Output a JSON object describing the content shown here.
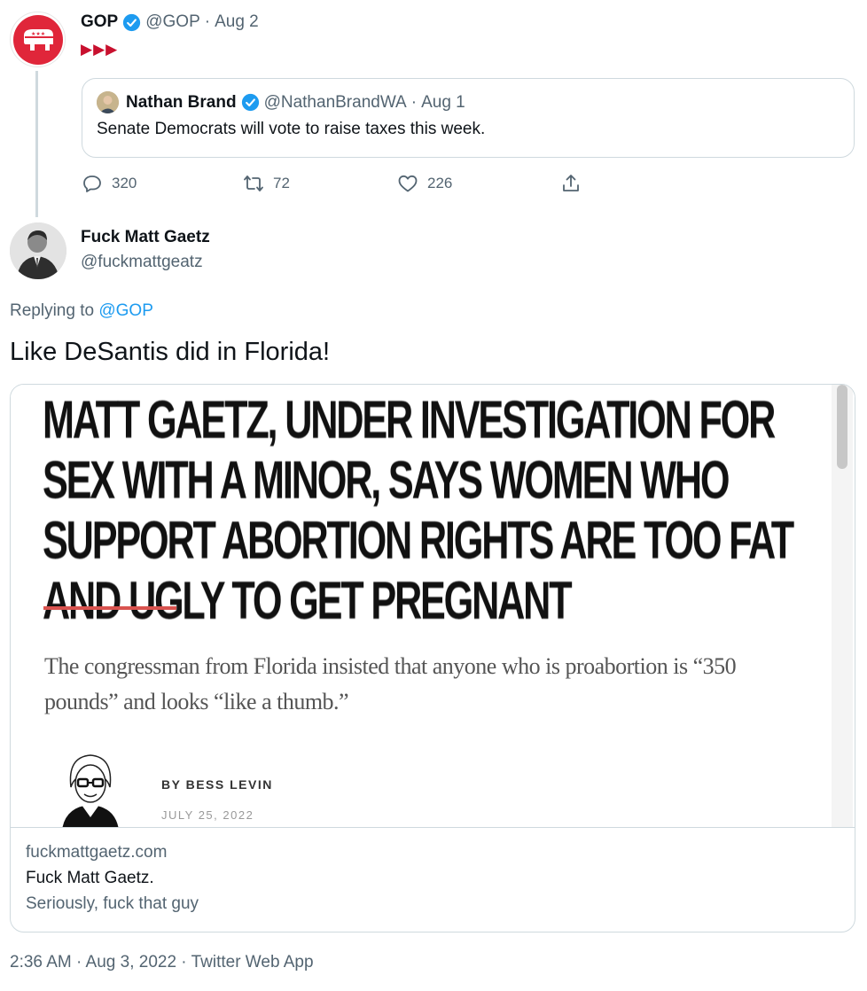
{
  "parent_tweet": {
    "name": "GOP",
    "handle": "@GOP",
    "separator": "·",
    "date": "Aug 2",
    "flags": "▶▶▶",
    "quoted": {
      "name": "Nathan Brand",
      "handle": "@NathanBrandWA",
      "separator": "·",
      "date": "Aug 1",
      "text": "Senate Democrats will vote to raise taxes this week."
    },
    "actions": {
      "replies": "320",
      "retweets": "72",
      "likes": "226"
    }
  },
  "reply_tweet": {
    "name": "Fuck Matt Gaetz",
    "handle": "@fuckmattgeatz",
    "replying_prefix": "Replying to ",
    "replying_to": "@GOP",
    "text": "Like DeSantis did in Florida!",
    "card": {
      "headline": "MATT GAETZ, UNDER INVESTIGATION FOR SEX WITH A MINOR, SAYS WOMEN WHO SUPPORT ABORTION RIGHTS ARE TOO FAT AND UGLY TO GET PREGNANT",
      "dek": "The congressman from Florida insisted that anyone who is proabortion is “350 pounds” and looks “like a thumb.”",
      "byline": "BY BESS LEVIN",
      "dateline": "JULY 25, 2022",
      "domain": "fuckmattgaetz.com",
      "title": "Fuck Matt Gaetz.",
      "description": "Seriously, fuck that guy"
    },
    "timestamp": "2:36 AM · Aug 3, 2022 · Twitter Web App"
  },
  "colors": {
    "accent": "#1d9bf0",
    "muted": "#536471",
    "border": "#cfd9de",
    "gop_red": "#e0263a",
    "rule_red": "#d9534f"
  }
}
